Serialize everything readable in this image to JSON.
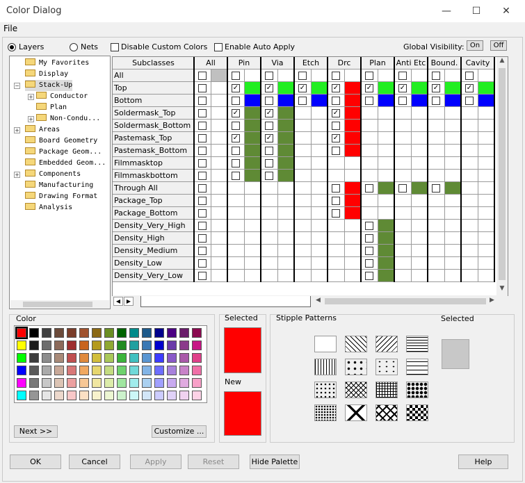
{
  "window": {
    "title": "Color Dialog"
  },
  "menu": {
    "file": "File"
  },
  "top": {
    "layers": "Layers",
    "nets": "Nets",
    "disable_custom": "Disable Custom Colors",
    "auto_apply": "Enable Auto Apply",
    "global_visibility": "Global Visibility:",
    "on": "On",
    "off": "Off"
  },
  "tree": [
    {
      "label": "My Favorites",
      "level": 1,
      "expander": ""
    },
    {
      "label": "Display",
      "level": 1,
      "expander": ""
    },
    {
      "label": "Stack-Up",
      "level": 1,
      "expander": "−",
      "selected": true
    },
    {
      "label": "Conductor",
      "level": 2,
      "expander": "+"
    },
    {
      "label": "Plan",
      "level": 2,
      "expander": ""
    },
    {
      "label": "Non-Condu...",
      "level": 2,
      "expander": "+"
    },
    {
      "label": "Areas",
      "level": 1,
      "expander": "+"
    },
    {
      "label": "Board Geometry",
      "level": 1,
      "expander": ""
    },
    {
      "label": "Package Geom...",
      "level": 1,
      "expander": ""
    },
    {
      "label": "Embedded Geom...",
      "level": 1,
      "expander": ""
    },
    {
      "label": "Components",
      "level": 1,
      "expander": "+"
    },
    {
      "label": "Manufacturing",
      "level": 1,
      "expander": ""
    },
    {
      "label": "Drawing Format",
      "level": 1,
      "expander": ""
    },
    {
      "label": "Analysis",
      "level": 1,
      "expander": ""
    }
  ],
  "grid": {
    "subclasses_header": "Subclasses",
    "columns": [
      "All",
      "Pin",
      "Via",
      "Etch",
      "Drc",
      "Plan",
      "Anti Etc",
      "Bound.",
      "Cavity"
    ],
    "rows": [
      {
        "label": "All",
        "checks": [
          0,
          0,
          0,
          0,
          0,
          0,
          0,
          0,
          0
        ],
        "colors": [
          "#c0c0c0",
          "",
          "",
          "",
          "",
          "",
          "",
          "",
          ""
        ]
      },
      {
        "label": "Top",
        "checks": [
          0,
          1,
          1,
          1,
          1,
          1,
          1,
          1,
          1
        ],
        "colors": [
          "",
          "#22ee22",
          "#22ee22",
          "#22ee22",
          "#ff0000",
          "#22ee22",
          "#22ee22",
          "#22ee22",
          "#22ee22"
        ]
      },
      {
        "label": "Bottom",
        "checks": [
          0,
          0,
          0,
          0,
          0,
          0,
          0,
          0,
          0
        ],
        "colors": [
          "",
          "#0000ff",
          "#0000ff",
          "#0000ff",
          "#ff0000",
          "#0000ff",
          "#0000ff",
          "#0000ff",
          "#0000ff"
        ]
      },
      {
        "label": "Soldermask_Top",
        "checks": [
          0,
          1,
          1,
          -1,
          1,
          -1,
          -1,
          -1,
          -1
        ],
        "colors": [
          "",
          "#5f8a35",
          "#5f8a35",
          "",
          "#ff0000",
          "",
          "",
          "",
          ""
        ]
      },
      {
        "label": "Soldermask_Bottom",
        "checks": [
          0,
          0,
          0,
          -1,
          0,
          -1,
          -1,
          -1,
          -1
        ],
        "colors": [
          "",
          "#5f8a35",
          "#5f8a35",
          "",
          "#ff0000",
          "",
          "",
          "",
          ""
        ]
      },
      {
        "label": "Pastemask_Top",
        "checks": [
          0,
          1,
          1,
          -1,
          1,
          -1,
          -1,
          -1,
          -1
        ],
        "colors": [
          "",
          "#5f8a35",
          "#5f8a35",
          "",
          "#ff0000",
          "",
          "",
          "",
          ""
        ]
      },
      {
        "label": "Pastemask_Bottom",
        "checks": [
          0,
          0,
          0,
          -1,
          0,
          -1,
          -1,
          -1,
          -1
        ],
        "colors": [
          "",
          "#5f8a35",
          "#5f8a35",
          "",
          "#ff0000",
          "",
          "",
          "",
          ""
        ]
      },
      {
        "label": "Filmmasktop",
        "checks": [
          0,
          0,
          0,
          -1,
          -1,
          -1,
          -1,
          -1,
          -1
        ],
        "colors": [
          "",
          "#5f8a35",
          "#5f8a35",
          "",
          "",
          "",
          "",
          "",
          ""
        ]
      },
      {
        "label": "Filmmaskbottom",
        "checks": [
          0,
          0,
          0,
          -1,
          -1,
          -1,
          -1,
          -1,
          -1
        ],
        "colors": [
          "",
          "#5f8a35",
          "#5f8a35",
          "",
          "",
          "",
          "",
          "",
          ""
        ]
      },
      {
        "label": "Through All",
        "checks": [
          0,
          -1,
          -1,
          -1,
          0,
          0,
          0,
          0,
          -1
        ],
        "colors": [
          "",
          "",
          "",
          "",
          "#ff0000",
          "#5f8a35",
          "#5f8a35",
          "#5f8a35",
          ""
        ]
      },
      {
        "label": "Package_Top",
        "checks": [
          0,
          -1,
          -1,
          -1,
          0,
          -1,
          -1,
          -1,
          -1
        ],
        "colors": [
          "",
          "",
          "",
          "",
          "#ff0000",
          "",
          "",
          "",
          ""
        ]
      },
      {
        "label": "Package_Bottom",
        "checks": [
          0,
          -1,
          -1,
          -1,
          0,
          -1,
          -1,
          -1,
          -1
        ],
        "colors": [
          "",
          "",
          "",
          "",
          "#ff0000",
          "",
          "",
          "",
          ""
        ]
      },
      {
        "label": "Density_Very_High",
        "checks": [
          0,
          -1,
          -1,
          -1,
          -1,
          0,
          -1,
          -1,
          -1
        ],
        "colors": [
          "",
          "",
          "",
          "",
          "",
          "#5f8a35",
          "",
          "",
          ""
        ]
      },
      {
        "label": "Density_High",
        "checks": [
          0,
          -1,
          -1,
          -1,
          -1,
          0,
          -1,
          -1,
          -1
        ],
        "colors": [
          "",
          "",
          "",
          "",
          "",
          "#5f8a35",
          "",
          "",
          ""
        ]
      },
      {
        "label": "Density_Medium",
        "checks": [
          0,
          -1,
          -1,
          -1,
          -1,
          0,
          -1,
          -1,
          -1
        ],
        "colors": [
          "",
          "",
          "",
          "",
          "",
          "#5f8a35",
          "",
          "",
          ""
        ]
      },
      {
        "label": "Density_Low",
        "checks": [
          0,
          -1,
          -1,
          -1,
          -1,
          0,
          -1,
          -1,
          -1
        ],
        "colors": [
          "",
          "",
          "",
          "",
          "",
          "#5f8a35",
          "",
          "",
          ""
        ]
      },
      {
        "label": "Density_Very_Low",
        "checks": [
          0,
          -1,
          -1,
          -1,
          -1,
          0,
          -1,
          -1,
          -1
        ],
        "colors": [
          "",
          "",
          "",
          "",
          "",
          "#5f8a35",
          "",
          "",
          ""
        ]
      }
    ]
  },
  "color_panel": {
    "label": "Color",
    "next": "Next >>",
    "customize": "Customize ...",
    "palette": [
      [
        "#ff0000",
        "#000000",
        "#404040",
        "#6b4a3a",
        "#7a3d2a",
        "#a0522d",
        "#8b6914",
        "#6b8e23",
        "#006400",
        "#008b8b",
        "#1e5a8a",
        "#00008b",
        "#4b0082",
        "#6a1b6a",
        "#8b0a50"
      ],
      [
        "#ffff00",
        "#1c1c1c",
        "#6e6e6e",
        "#8c6a5a",
        "#9e3030",
        "#c8641e",
        "#b49a1e",
        "#8fa832",
        "#228b22",
        "#20a0a0",
        "#3a78b4",
        "#0000cd",
        "#6a3aa8",
        "#8b3a8b",
        "#c71585"
      ],
      [
        "#00ff00",
        "#3c3c3c",
        "#8c8c8c",
        "#a88a78",
        "#c05050",
        "#e08a3c",
        "#d2be3c",
        "#aac85a",
        "#3cb43c",
        "#40c0c0",
        "#5a96d2",
        "#3c3cff",
        "#8a5ac8",
        "#aa5aaa",
        "#e0408a"
      ],
      [
        "#0000ff",
        "#5a5a5a",
        "#aaaaaa",
        "#c8a898",
        "#d87878",
        "#f0a860",
        "#e6d66e",
        "#c4dc82",
        "#6ed26e",
        "#70d8d8",
        "#82b4e6",
        "#6e6eff",
        "#a882dc",
        "#c882c8",
        "#f070a8"
      ],
      [
        "#ff00ff",
        "#787878",
        "#c8c8c8",
        "#dcc4b4",
        "#eca0a0",
        "#f8c896",
        "#f0e6a0",
        "#dcecaa",
        "#a0e6a0",
        "#a0ecec",
        "#aad0f0",
        "#a0a0ff",
        "#c8aaf0",
        "#e0aae0",
        "#f8a0c8"
      ],
      [
        "#00ffff",
        "#969696",
        "#e6e6e6",
        "#ecd8cc",
        "#f8c8c8",
        "#fce0c4",
        "#f8f2cc",
        "#ecf6d2",
        "#ccf2cc",
        "#ccf6f6",
        "#d2e6f8",
        "#ccccff",
        "#e0d2f8",
        "#f0d2f0",
        "#fcd2e6"
      ]
    ]
  },
  "selected_panel": {
    "label": "Selected",
    "new_label": "New",
    "selected_color": "#ff0000",
    "new_color": "#ff0000"
  },
  "stipple": {
    "label": "Stipple Patterns",
    "selected_label": "Selected",
    "selected_color": "#c8c8c8"
  },
  "buttons": {
    "ok": "OK",
    "cancel": "Cancel",
    "apply": "Apply",
    "reset": "Reset",
    "hide_palette": "Hide Palette",
    "help": "Help"
  }
}
